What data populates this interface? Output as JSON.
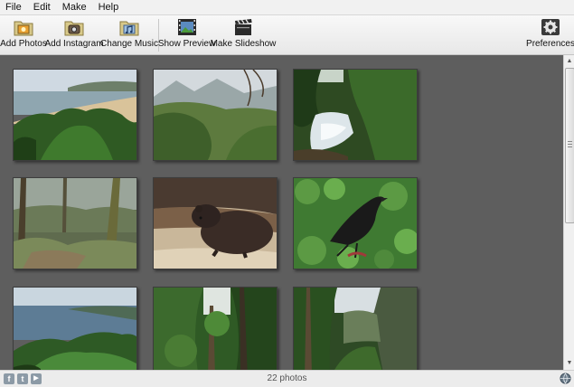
{
  "menu": [
    "File",
    "Edit",
    "Make",
    "Help"
  ],
  "toolbar": {
    "add_photos": "Add Photos",
    "add_instagram": "Add Instagram",
    "change_music": "Change Music",
    "show_preview": "Show Preview",
    "make_slideshow": "Make Slideshow",
    "preferences": "Preferences"
  },
  "gallery": {
    "photos": [
      {
        "subject": "coastal beach with shrubs"
      },
      {
        "subject": "green valley with mountains"
      },
      {
        "subject": "forest waterfall"
      },
      {
        "subject": "mossy rainforest trees"
      },
      {
        "subject": "wombat on sand"
      },
      {
        "subject": "raven on leafy plants"
      },
      {
        "subject": "coastal bay view"
      },
      {
        "subject": "tall forest trees"
      },
      {
        "subject": "forest ravine"
      }
    ]
  },
  "status": {
    "photo_count": "22 photos",
    "social_icons": [
      "facebook-icon",
      "twitter-icon",
      "youtube-icon"
    ]
  },
  "colors": {
    "gallery_bg": "#5e5e5e",
    "toolbar_bg": "#f0f0f0"
  }
}
